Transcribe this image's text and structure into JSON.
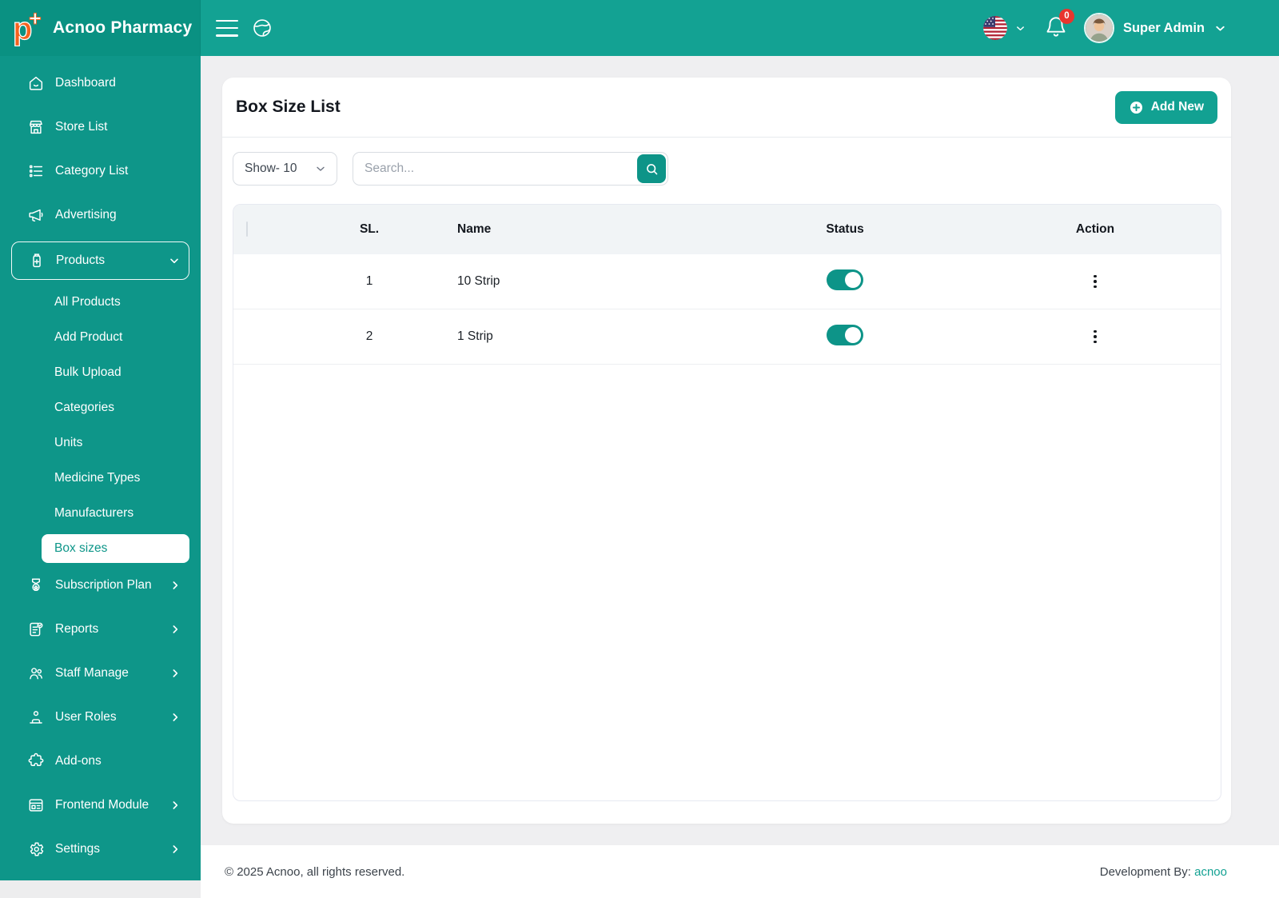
{
  "brand": {
    "name": "Acnoo Pharmacy",
    "logo_letter": "p",
    "logo_plus": "+"
  },
  "colors": {
    "accent_teal": "#0d9488",
    "topbar_bg": "#13a293",
    "sidebar_bg": "#0e9689",
    "logo_area_bg": "#0a9182",
    "logo_orange": "#f4621e",
    "badge_red": "#e8352e",
    "link_teal": "#12a192"
  },
  "topbar": {
    "menu_icon": "hamburger-menu-icon",
    "fullscreen_icon": "globe-icon",
    "language_icon": "us-flag-icon",
    "notification_icon": "bell-icon",
    "notification_count": "0",
    "user_name": "Super Admin",
    "user_avatar": "avatar"
  },
  "sidebar": {
    "items": [
      {
        "label": "Dashboard",
        "icon": "home-icon"
      },
      {
        "label": "Store List",
        "icon": "store-icon"
      },
      {
        "label": "Category List",
        "icon": "category-list-icon"
      },
      {
        "label": "Advertising",
        "icon": "megaphone-icon"
      },
      {
        "label": "Products",
        "icon": "medicine-bottle-icon",
        "expanded": true,
        "children": [
          {
            "label": "All Products"
          },
          {
            "label": "Add Product"
          },
          {
            "label": "Bulk Upload"
          },
          {
            "label": "Categories"
          },
          {
            "label": "Units"
          },
          {
            "label": "Medicine Types"
          },
          {
            "label": "Manufacturers"
          },
          {
            "label": "Box sizes",
            "active": true
          }
        ]
      },
      {
        "label": "Subscription Plan",
        "icon": "award-icon",
        "expandable": true
      },
      {
        "label": "Reports",
        "icon": "report-icon",
        "expandable": true
      },
      {
        "label": "Staff Manage",
        "icon": "staff-icon",
        "expandable": true
      },
      {
        "label": "User Roles",
        "icon": "user-roles-icon",
        "expandable": true
      },
      {
        "label": "Add-ons",
        "icon": "puzzle-icon"
      },
      {
        "label": "Frontend Module",
        "icon": "browser-icon",
        "expandable": true
      },
      {
        "label": "Settings",
        "icon": "gear-icon",
        "expandable": true
      }
    ]
  },
  "main": {
    "page_title": "Box Size List",
    "add_new_label": "Add New",
    "add_new_icon": "plus-circle-icon",
    "show_select_label": "Show- 10",
    "search_placeholder": "Search...",
    "search_icon": "search-icon",
    "table": {
      "headers": [
        "SL.",
        "Name",
        "Status",
        "Action"
      ],
      "rows": [
        {
          "sl": "1",
          "name": "10 Strip",
          "status_on": true
        },
        {
          "sl": "2",
          "name": "1 Strip",
          "status_on": true
        }
      ]
    }
  },
  "footer": {
    "copyright": "© 2025 Acnoo, all rights reserved.",
    "dev_by_label": "Development By: ",
    "dev_link_label": "acnoo"
  }
}
